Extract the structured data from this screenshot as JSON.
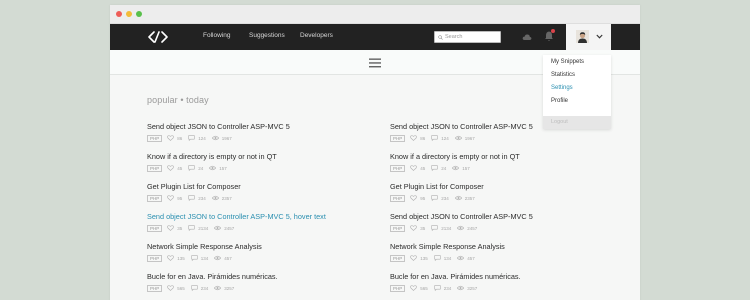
{
  "nav": {
    "links": [
      "Following",
      "Suggestions",
      "Developers"
    ],
    "search_placeholder": "Search"
  },
  "dropdown": {
    "items": [
      "My Snippets",
      "Statistics",
      "Settings",
      "Profile"
    ],
    "active_item": "Settings",
    "logout": "Logout"
  },
  "heading": "popular • today",
  "colors": {
    "accent": "#2a8fb0",
    "nav_bg": "#222222",
    "page_bg": "#d3dbd3"
  },
  "snippets_left": [
    {
      "title": "Send object JSON to Controller ASP-MVC 5",
      "tag": "PHP",
      "likes": "86",
      "comments": "124",
      "views": "1967"
    },
    {
      "title": "Know if a directory is empty or not in QT",
      "tag": "PHP",
      "likes": "45",
      "comments": "24",
      "views": "157"
    },
    {
      "title": "Get Plugin List for Composer",
      "tag": "PHP",
      "likes": "95",
      "comments": "234",
      "views": "2357"
    },
    {
      "title": "Send object JSON to Controller ASP-MVC 5, hover text",
      "tag": "PHP",
      "likes": "35",
      "comments": "2134",
      "views": "2457",
      "hover": true
    },
    {
      "title": "Network Simple Response Analysis",
      "tag": "PHP",
      "likes": "135",
      "comments": "134",
      "views": "457"
    },
    {
      "title": "Bucle for en Java. Pirámides numéricas.",
      "tag": "PHP",
      "likes": "565",
      "comments": "234",
      "views": "3257"
    }
  ],
  "snippets_right": [
    {
      "title": "Send object JSON to Controller ASP-MVC 5",
      "tag": "PHP",
      "likes": "86",
      "comments": "124",
      "views": "1967"
    },
    {
      "title": "Know if a directory is empty or not in QT",
      "tag": "PHP",
      "likes": "45",
      "comments": "24",
      "views": "157"
    },
    {
      "title": "Get Plugin List for Composer",
      "tag": "PHP",
      "likes": "95",
      "comments": "234",
      "views": "2357"
    },
    {
      "title": "Send object JSON to Controller ASP-MVC 5",
      "tag": "PHP",
      "likes": "35",
      "comments": "2134",
      "views": "2457"
    },
    {
      "title": "Network Simple Response Analysis",
      "tag": "PHP",
      "likes": "135",
      "comments": "134",
      "views": "457"
    },
    {
      "title": "Bucle for en Java. Pirámides numéricas.",
      "tag": "PHP",
      "likes": "565",
      "comments": "234",
      "views": "3257"
    }
  ]
}
